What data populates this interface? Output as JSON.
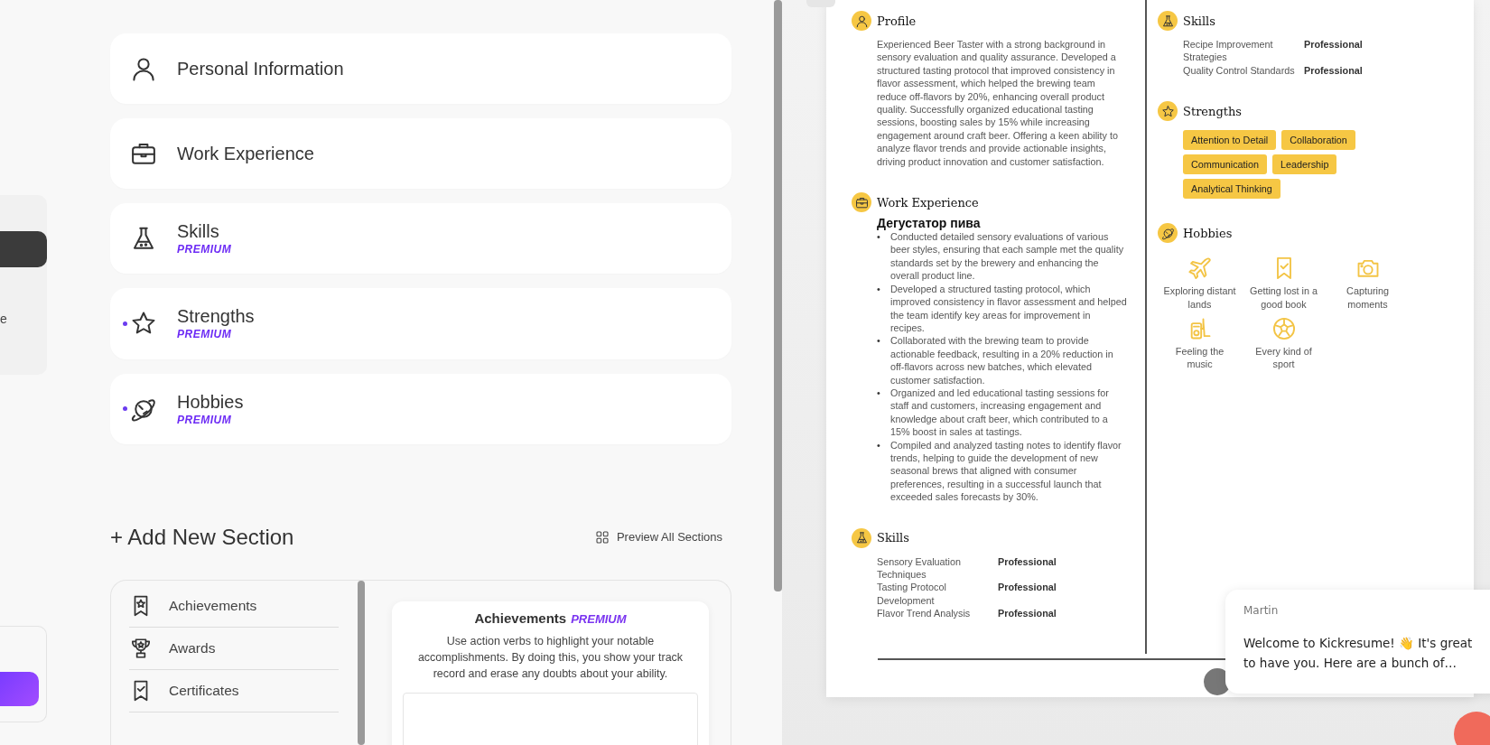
{
  "sidebar_fragment": {
    "text": "e"
  },
  "sections": [
    {
      "title": "Personal Information",
      "marked": false
    },
    {
      "title": "Work Experience",
      "marked": false
    },
    {
      "title": "Skills",
      "badge": "PREMIUM",
      "marked": false
    },
    {
      "title": "Strengths",
      "badge": "PREMIUM",
      "marked": true
    },
    {
      "title": "Hobbies",
      "badge": "PREMIUM",
      "marked": true
    }
  ],
  "add_section": {
    "title": "+ Add New Section",
    "preview_link": "Preview All Sections"
  },
  "section_list": [
    {
      "label": "Achievements"
    },
    {
      "label": "Awards"
    },
    {
      "label": "Certificates"
    }
  ],
  "section_preview": {
    "title": "Achievements",
    "badge": "PREMIUM",
    "description": "Use action verbs to highlight your notable accomplishments. By doing this, you show your track record and erase any doubts about your ability."
  },
  "resume": {
    "profile": {
      "heading": "Profile",
      "text": "Experienced Beer Taster with a strong background in sensory evaluation and quality assurance. Developed a structured tasting protocol that improved consistency in flavor assessment, which helped the brewing team reduce off-flavors by 20%, enhancing overall product quality. Successfully organized educational tasting sessions, boosting sales by 15% while increasing engagement around craft beer. Offering a keen ability to analyze flavor trends and provide actionable insights, driving product innovation and customer satisfaction."
    },
    "work_experience": {
      "heading": "Work Experience",
      "jobs": [
        {
          "title": "Дегустатор пива",
          "bullets": [
            {
              "marker": "•",
              "text": "Conducted detailed sensory evaluations of various beer styles, ensuring that each sample met the quality standards set by the brewery and enhancing the overall product line."
            },
            {
              "marker": "•",
              "text": "Developed a structured tasting protocol, which improved consistency in flavor assessment and helped the team identify key areas for improvement in recipes."
            },
            {
              "marker": "•",
              "text": "Collaborated with the brewing team to provide actionable feedback, resulting in a 20% reduction in off-flavors across new batches, which elevated customer satisfaction."
            },
            {
              "marker": "•",
              "text": "Organized and led educational tasting sessions for staff and customers, increasing engagement and knowledge about craft beer, which contributed to a 15% boost in sales at tastings."
            },
            {
              "marker": "•",
              "text": "Compiled and analyzed tasting notes to identify flavor trends, helping to guide the development of new seasonal brews that aligned with consumer preferences, resulting in a successful launch that exceeded sales forecasts by 30%."
            }
          ]
        }
      ]
    },
    "skills_left": {
      "heading": "Skills",
      "items": [
        {
          "name": "Sensory Evaluation Techniques",
          "proficiency": "Professional"
        },
        {
          "name": "Tasting Protocol Development",
          "proficiency": "Professional"
        },
        {
          "name": "Flavor Trend Analysis",
          "proficiency": "Professional"
        }
      ]
    },
    "skills_right": {
      "heading": "Skills",
      "items": [
        {
          "name": "Recipe Improvement Strategies",
          "proficiency": "Professional"
        },
        {
          "name": "Quality Control Standards",
          "proficiency": "Professional"
        }
      ]
    },
    "strengths": {
      "heading": "Strengths",
      "tags": [
        "Attention to Detail",
        "Collaboration",
        "Communication",
        "Leadership",
        "Analytical Thinking"
      ]
    },
    "hobbies": {
      "heading": "Hobbies",
      "items": [
        {
          "label": "Exploring distant lands"
        },
        {
          "label": "Getting lost in a good book"
        },
        {
          "label": "Capturing moments"
        },
        {
          "label": "Feeling the music"
        },
        {
          "label": "Every kind of sport"
        }
      ]
    }
  },
  "chat": {
    "sender": "Martin",
    "message": "Welcome to Kickresume! 👋 It's great to have you. Here are a bunch of…"
  }
}
